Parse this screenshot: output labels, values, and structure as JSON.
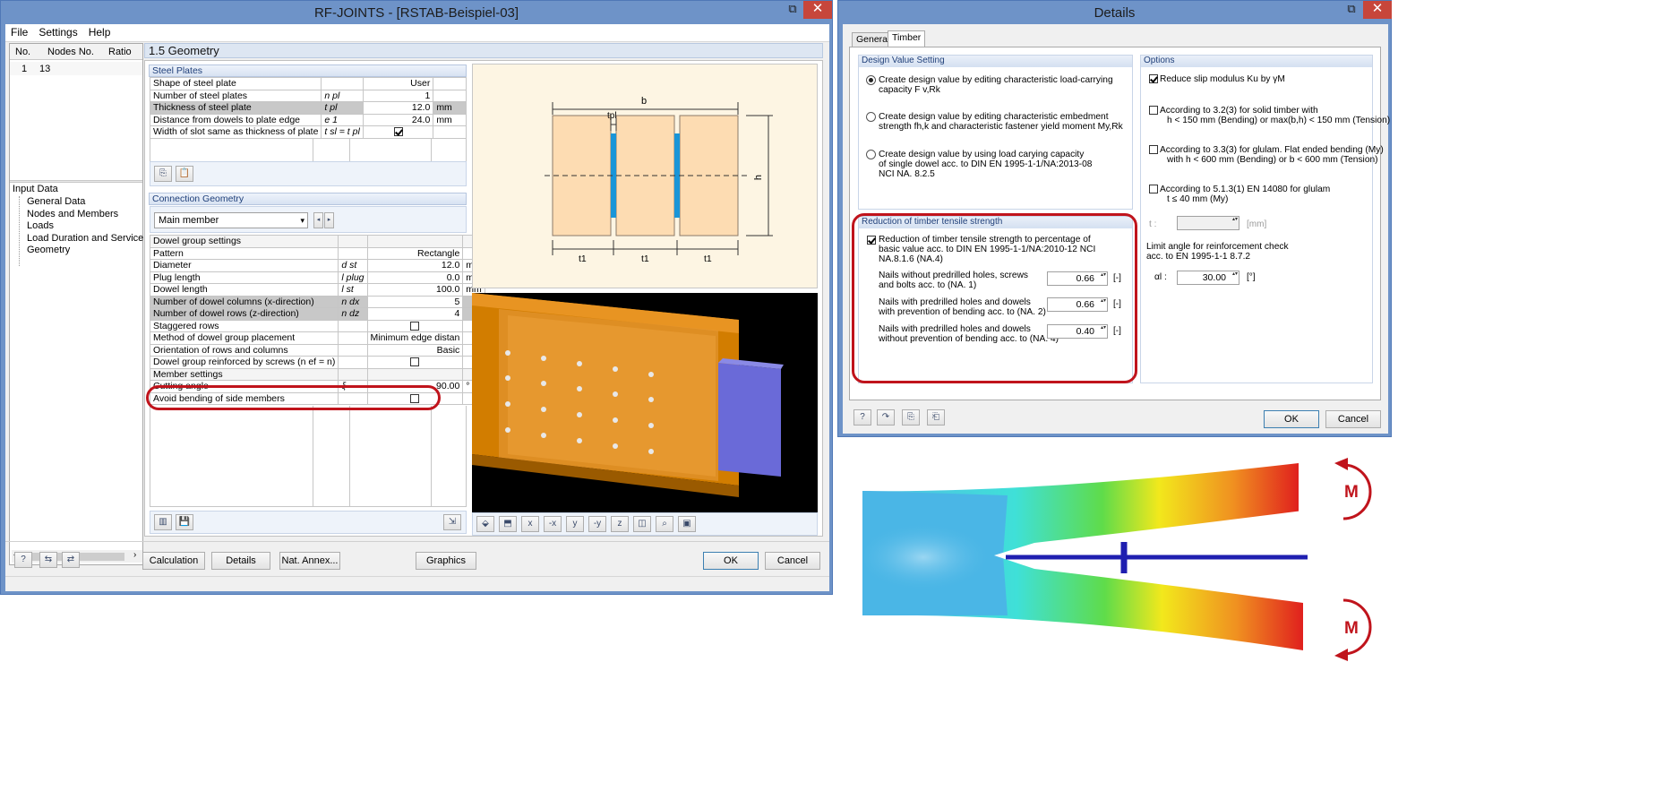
{
  "main_window": {
    "title": "RF-JOINTS - [RSTAB-Beispiel-03]",
    "menu": [
      "File",
      "Settings",
      "Help"
    ],
    "left_table": {
      "headers": [
        "No.",
        "Nodes No.",
        "Ratio"
      ],
      "rows": [
        {
          "no": "1",
          "nodes": "13",
          "ratio": ""
        }
      ]
    },
    "tree": {
      "root": "Input Data",
      "items": [
        "General Data",
        "Nodes and Members",
        "Loads",
        "Load Duration and Service Clas",
        "Geometry"
      ]
    },
    "section_title": "1.5 Geometry",
    "steel_plates": {
      "header": "Steel Plates",
      "rows": [
        {
          "label": "Shape of steel plate",
          "sym": "",
          "value": "User",
          "unit": ""
        },
        {
          "label": "Number of steel plates",
          "sym": "n pl",
          "value": "1",
          "unit": ""
        },
        {
          "label": "Thickness of steel plate",
          "sym": "t pl",
          "value": "12.0",
          "unit": "mm"
        },
        {
          "label": "Distance from dowels to plate edge",
          "sym": "e 1",
          "value": "24.0",
          "unit": "mm"
        },
        {
          "label": "Width of slot same as thickness of plate",
          "sym": "t sl = t pl",
          "value": "",
          "unit": ""
        }
      ]
    },
    "connection_geometry": {
      "header": "Connection Geometry",
      "member_select": "Main member",
      "rows": [
        {
          "label": "Dowel group settings",
          "sym": "",
          "value": "",
          "unit": ""
        },
        {
          "label": "Pattern",
          "sym": "",
          "value": "Rectangle",
          "unit": ""
        },
        {
          "label": "Diameter",
          "sym": "d st",
          "value": "12.0",
          "unit": "mm"
        },
        {
          "label": "Plug length",
          "sym": "l plug",
          "value": "0.0",
          "unit": "mm"
        },
        {
          "label": "Dowel length",
          "sym": "l st",
          "value": "100.0",
          "unit": "mm"
        },
        {
          "label": "Number of dowel columns (x-direction)",
          "sym": "n dx",
          "value": "5",
          "unit": ""
        },
        {
          "label": "Number of dowel rows (z-direction)",
          "sym": "n dz",
          "value": "4",
          "unit": ""
        },
        {
          "label": "Staggered rows",
          "sym": "",
          "value": "",
          "unit": ""
        },
        {
          "label": "Method of dowel group placement",
          "sym": "",
          "value": "Minimum edge distan",
          "unit": ""
        },
        {
          "label": "Orientation of rows and columns",
          "sym": "",
          "value": "Basic",
          "unit": ""
        },
        {
          "label": "Dowel group reinforced by screws (n ef = n)",
          "sym": "",
          "value": "",
          "unit": ""
        },
        {
          "label": "Member settings",
          "sym": "",
          "value": "",
          "unit": ""
        },
        {
          "label": "Cutting angle",
          "sym": "ξ",
          "value": "90.00",
          "unit": "°"
        },
        {
          "label": "Avoid bending of side members",
          "sym": "",
          "value": "",
          "unit": ""
        }
      ]
    },
    "drawing": {
      "dim_b": "b",
      "dim_tpl": "tpl",
      "dim_h": "h",
      "dim_t1": [
        "t1",
        "t1",
        "t1"
      ]
    },
    "buttons": {
      "calculation": "Calculation",
      "details": "Details",
      "nat_annex": "Nat. Annex...",
      "graphics": "Graphics",
      "ok": "OK",
      "cancel": "Cancel"
    }
  },
  "details_window": {
    "title": "Details",
    "tabs": [
      "General",
      "Timber"
    ],
    "design_value": {
      "header": "Design Value Setting",
      "options": [
        {
          "line1": "Create design value by editing characteristic load-carrying",
          "line2": "capacity F v,Rk",
          "line3": "",
          "selected": true
        },
        {
          "line1": "Create design value by editing characteristic embedment",
          "line2": "strength fh,k and characteristic fastener yield moment My,Rk",
          "line3": "",
          "selected": false
        },
        {
          "line1": "Create design value by using load carying capacity",
          "line2": "of single dowel acc. to DIN EN 1995-1-1/NA:2013-08",
          "line3": "NCI NA. 8.2.5",
          "selected": false
        }
      ]
    },
    "reduction": {
      "header": "Reduction of timber tensile strength",
      "check_line1": "Reduction of timber tensile strength to percentage of",
      "check_line2": "basic value acc. to DIN EN 1995-1-1/NA:2010-12 NCI",
      "check_line3": "NA.8.1.6 (NA.4)",
      "rows": [
        {
          "line1": "Nails without predrilled holes, screws",
          "line2": "and bolts acc. to (NA. 1)",
          "value": "0.66",
          "unit": "[-]"
        },
        {
          "line1": "Nails with predrilled holes and dowels",
          "line2": "with prevention of bending acc. to (NA. 2)",
          "value": "0.66",
          "unit": "[-]"
        },
        {
          "line1": "Nails with predrilled holes and dowels",
          "line2": "without prevention of bending acc. to (NA. 4)",
          "value": "0.40",
          "unit": "[-]"
        }
      ]
    },
    "options": {
      "header": "Options",
      "reduce_slip": "Reduce slip modulus Ku by γM",
      "items": [
        {
          "line1": "According to 3.2(3) for solid timber with",
          "line2": "h < 150 mm (Bending) or max(b,h) < 150 mm (Tension)"
        },
        {
          "line1": "According to 3.3(3) for glulam. Flat ended bending (My)",
          "line2": "with h < 600 mm (Bending) or b < 600 mm (Tension)"
        },
        {
          "line1": "According to 5.1.3(1) EN 14080 for glulam",
          "line2": "t ≤ 40 mm (My)"
        }
      ],
      "t_label": "t :",
      "t_unit": "[mm]",
      "limit_line1": "Limit angle for reinforcement check",
      "limit_line2": "acc. to EN 1995-1-1 8.7.2",
      "alpha_label": "αl :",
      "alpha_value": "30.00",
      "alpha_unit": "[°]"
    },
    "buttons": {
      "ok": "OK",
      "cancel": "Cancel"
    }
  },
  "moment_figure": {
    "label_top": "M",
    "label_bottom": "M"
  }
}
